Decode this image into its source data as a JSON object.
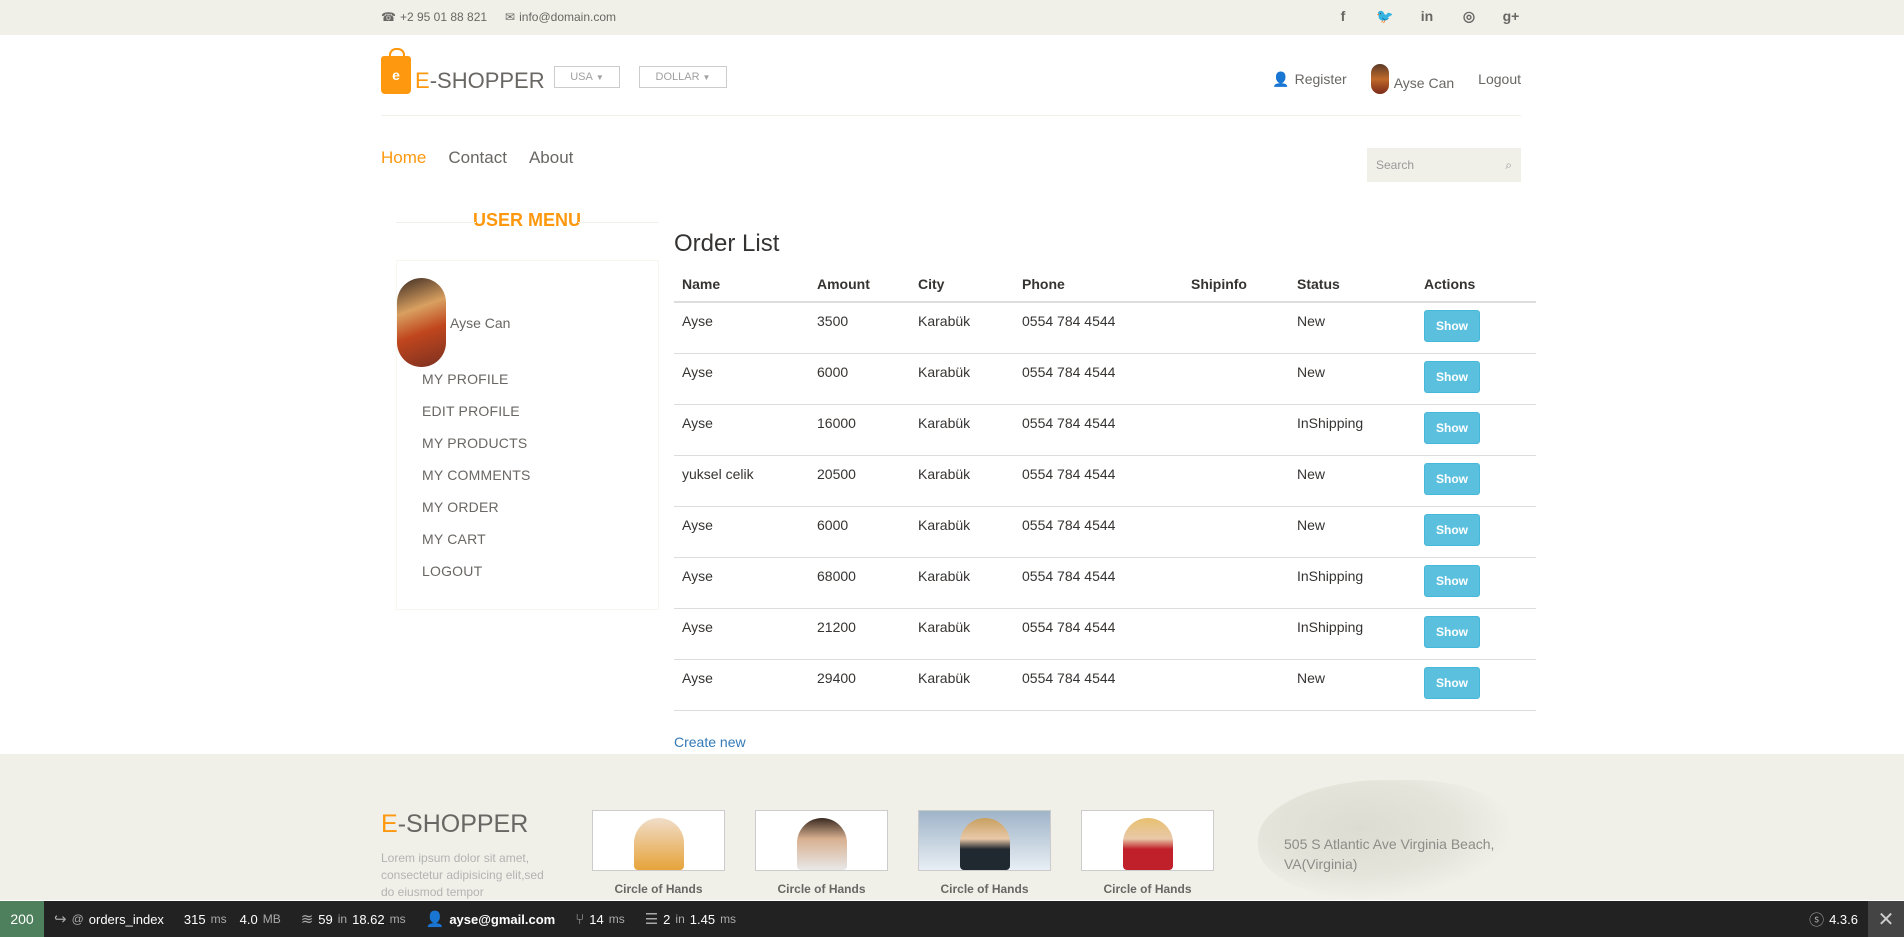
{
  "topbar": {
    "phone": "+2 95 01 88 821",
    "email": "info@domain.com",
    "social": [
      "facebook-icon",
      "twitter-icon",
      "linkedin-icon",
      "dribbble-icon",
      "google-plus-icon"
    ],
    "social_glyphs": [
      "f",
      "🐦",
      "in",
      "◎",
      "g+"
    ]
  },
  "header": {
    "logo_prefix": "E",
    "logo_rest": "-SHOPPER",
    "bag_letter": "e",
    "country": "USA",
    "currency": "DOLLAR",
    "register": "Register",
    "user": "Ayse Can",
    "logout": "Logout"
  },
  "mainmenu": {
    "home": "Home",
    "contact": "Contact",
    "about": "About",
    "search_placeholder": "Search"
  },
  "usermenu": {
    "title": "USER MENU",
    "name": "Ayse Can",
    "items": [
      "MY PROFILE",
      "EDIT PROFILE",
      "MY PRODUCTS",
      "MY COMMENTS",
      "MY ORDER",
      "MY CART",
      "LOGOUT"
    ]
  },
  "orders": {
    "title": "Order List",
    "columns": [
      "Name",
      "Amount",
      "City",
      "Phone",
      "Shipinfo",
      "Status",
      "Actions"
    ],
    "rows": [
      {
        "name": "Ayse",
        "amount": "3500",
        "city": "Karabük",
        "phone": "0554 784 4544",
        "shipinfo": "",
        "status": "New",
        "action": "Show"
      },
      {
        "name": "Ayse",
        "amount": "6000",
        "city": "Karabük",
        "phone": "0554 784 4544",
        "shipinfo": "",
        "status": "New",
        "action": "Show"
      },
      {
        "name": "Ayse",
        "amount": "16000",
        "city": "Karabük",
        "phone": "0554 784 4544",
        "shipinfo": "",
        "status": "InShipping",
        "action": "Show"
      },
      {
        "name": "yuksel celik",
        "amount": "20500",
        "city": "Karabük",
        "phone": "0554 784 4544",
        "shipinfo": "",
        "status": "New",
        "action": "Show"
      },
      {
        "name": "Ayse",
        "amount": "6000",
        "city": "Karabük",
        "phone": "0554 784 4544",
        "shipinfo": "",
        "status": "New",
        "action": "Show"
      },
      {
        "name": "Ayse",
        "amount": "68000",
        "city": "Karabük",
        "phone": "0554 784 4544",
        "shipinfo": "",
        "status": "InShipping",
        "action": "Show"
      },
      {
        "name": "Ayse",
        "amount": "21200",
        "city": "Karabük",
        "phone": "0554 784 4544",
        "shipinfo": "",
        "status": "InShipping",
        "action": "Show"
      },
      {
        "name": "Ayse",
        "amount": "29400",
        "city": "Karabük",
        "phone": "0554 784 4544",
        "shipinfo": "",
        "status": "New",
        "action": "Show"
      }
    ],
    "create_new": "Create new"
  },
  "footer": {
    "logo_prefix": "E",
    "logo_rest": "-SHOPPER",
    "lorem": "Lorem ipsum dolor sit amet, consectetur adipisicing elit,sed do eiusmod tempor",
    "thumbs": [
      "Circle of Hands",
      "Circle of Hands",
      "Circle of Hands",
      "Circle of Hands"
    ],
    "address": "505 S Atlantic Ave Virginia Beach, VA(Virginia)"
  },
  "debug_toolbar": {
    "status_code": "200",
    "route": "orders_index",
    "route_prefix": "@",
    "time_value": "315",
    "time_unit": "ms",
    "memory_value": "4.0",
    "memory_unit": "MB",
    "twig_count": "59",
    "twig_in": "in",
    "twig_time": "18.62",
    "twig_unit": "ms",
    "user": "ayse@gmail.com",
    "event_value": "14",
    "event_unit": "ms",
    "db_count": "2",
    "db_in": "in",
    "db_time": "1.45",
    "db_unit": "ms",
    "version": "4.3.6"
  },
  "colors": {
    "accent": "#fe980f",
    "button": "#5bc0de",
    "link": "#337ab7",
    "toolbar_status": "#4f805d"
  }
}
